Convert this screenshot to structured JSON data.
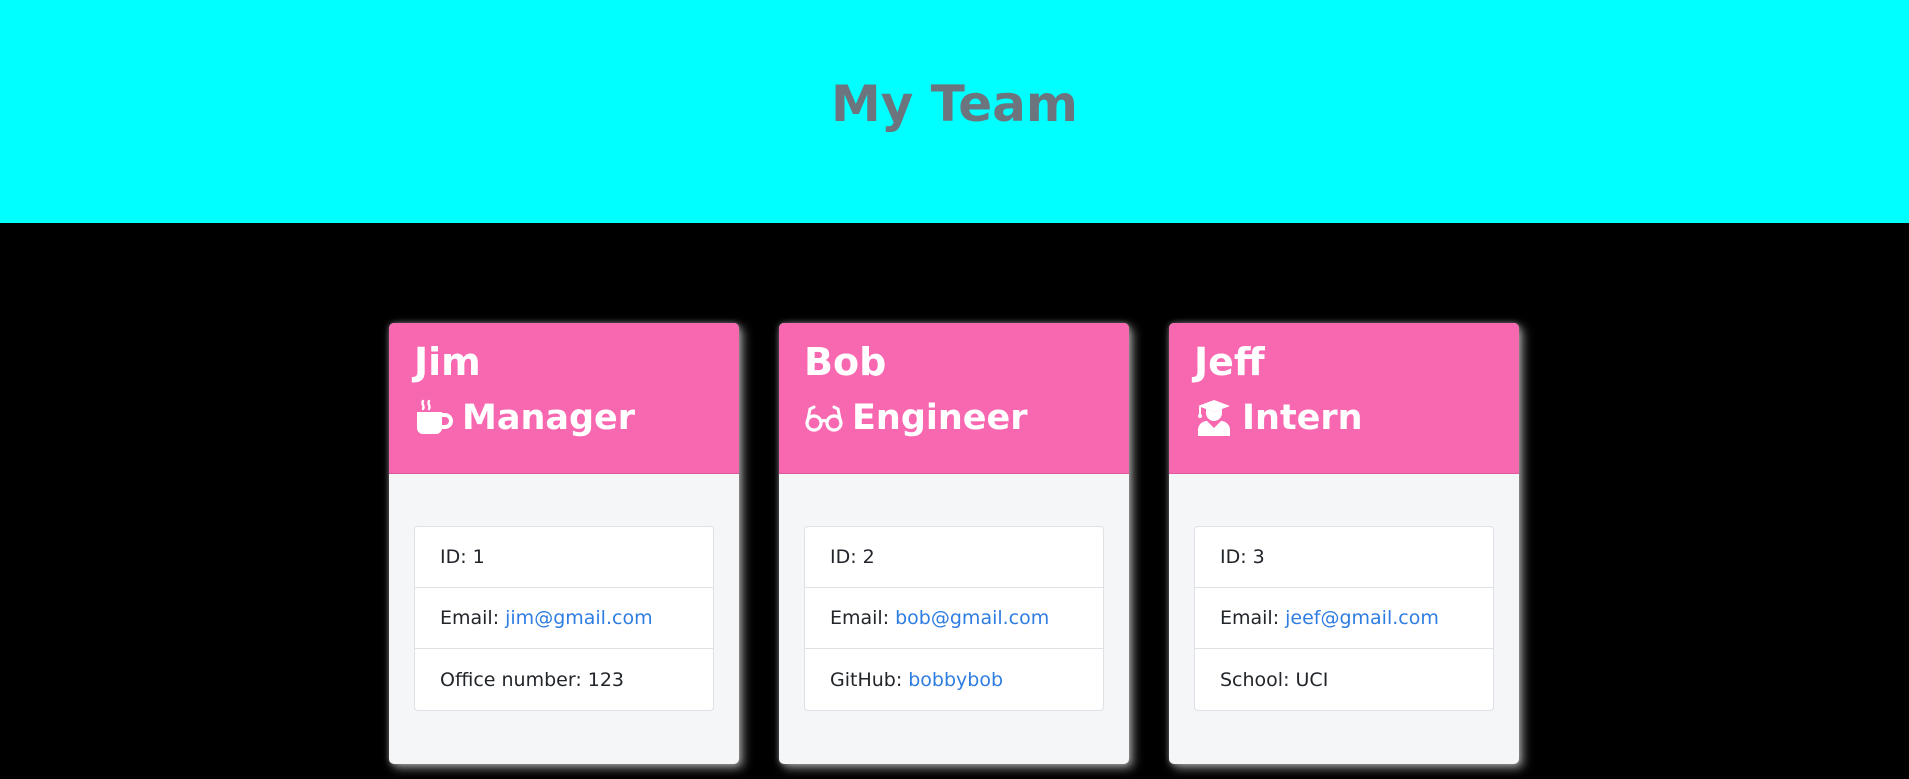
{
  "header": {
    "title": "My Team"
  },
  "cards": [
    {
      "name": "Jim",
      "role": "Manager",
      "role_icon": "coffee-mug-icon",
      "id_text": "ID: 1",
      "email_label": "Email:",
      "email": "jim@gmail.com",
      "extra_label": "Office number: 123",
      "extra_link": ""
    },
    {
      "name": "Bob",
      "role": "Engineer",
      "role_icon": "glasses-icon",
      "id_text": "ID: 2",
      "email_label": "Email:",
      "email": "bob@gmail.com",
      "extra_label": "GitHub:",
      "extra_link": "bobbybob"
    },
    {
      "name": "Jeff",
      "role": "Intern",
      "role_icon": "graduate-icon",
      "id_text": "ID: 3",
      "email_label": "Email:",
      "email": "jeef@gmail.com",
      "extra_label": "School: UCI",
      "extra_link": ""
    }
  ],
  "colors": {
    "header_bg": "#00ffff",
    "page_bg": "#000000",
    "card_header_bg": "#f868b1",
    "link": "#2f7de1",
    "title": "#6c757d"
  }
}
